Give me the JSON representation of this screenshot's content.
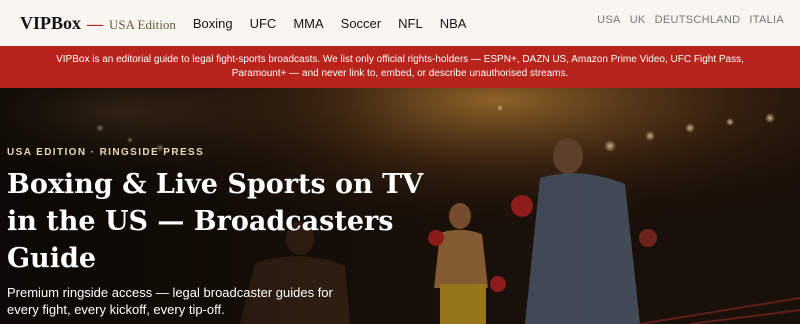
{
  "brand": {
    "name": "VIPBox",
    "dash": "—",
    "edition": "USA Edition"
  },
  "nav": [
    {
      "label": "Boxing"
    },
    {
      "label": "UFC"
    },
    {
      "label": "MMA"
    },
    {
      "label": "Soccer"
    },
    {
      "label": "NFL"
    },
    {
      "label": "NBA"
    }
  ],
  "languages": [
    {
      "label": "USA"
    },
    {
      "label": "UK"
    },
    {
      "label": "DEUTSCHLAND"
    },
    {
      "label": "ITALIA"
    }
  ],
  "notice": {
    "text": "VIPBox is an editorial guide to legal fight-sports broadcasts. We list only official rights-holders — ESPN+, DAZN US, Amazon Prime Video, UFC Fight Pass, Paramount+ — and never link to, embed, or describe unauthorised streams."
  },
  "hero": {
    "eyebrow": "USA EDITION · RINGSIDE PRESS",
    "title": "Boxing & Live Sports on TV in the US — Broadcasters Guide",
    "subtitle": "Premium ringside access — legal broadcaster guides for every fight, every kickoff, every tip-off."
  },
  "colors": {
    "accent": "#b8231c",
    "background": "#f8f6f1",
    "text": "#141414"
  }
}
